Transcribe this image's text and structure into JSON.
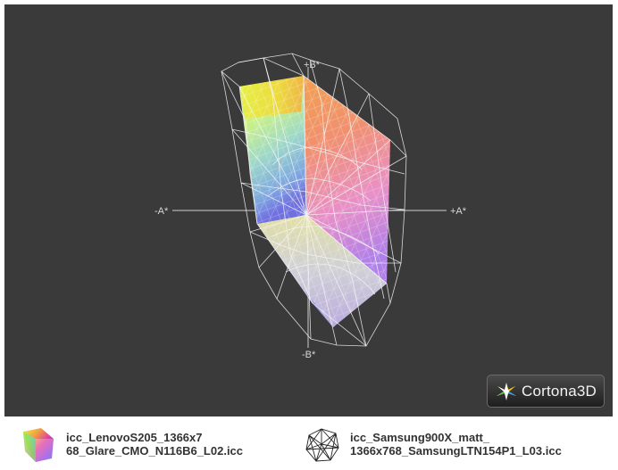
{
  "viewer": {
    "background": "#3a3a3a",
    "axis_labels": {
      "plus_a": "+A*",
      "minus_a": "-A*",
      "plus_b": "+B*",
      "minus_b": "-B*"
    },
    "logo": {
      "text": "Cortona3D",
      "icon": "cortona-star-icon"
    }
  },
  "legend": [
    {
      "line1": "icc_LenovoS205_1366x7",
      "line2": "68_Glare_CMO_N116B6_L02.icc",
      "icon": "colored-gamut-solid-icon"
    },
    {
      "line1": "icc_Samsung900X_matt_",
      "line2": "1366x768_SamsungLTN154P1_L03.icc",
      "icon": "wireframe-gamut-icon"
    }
  ]
}
